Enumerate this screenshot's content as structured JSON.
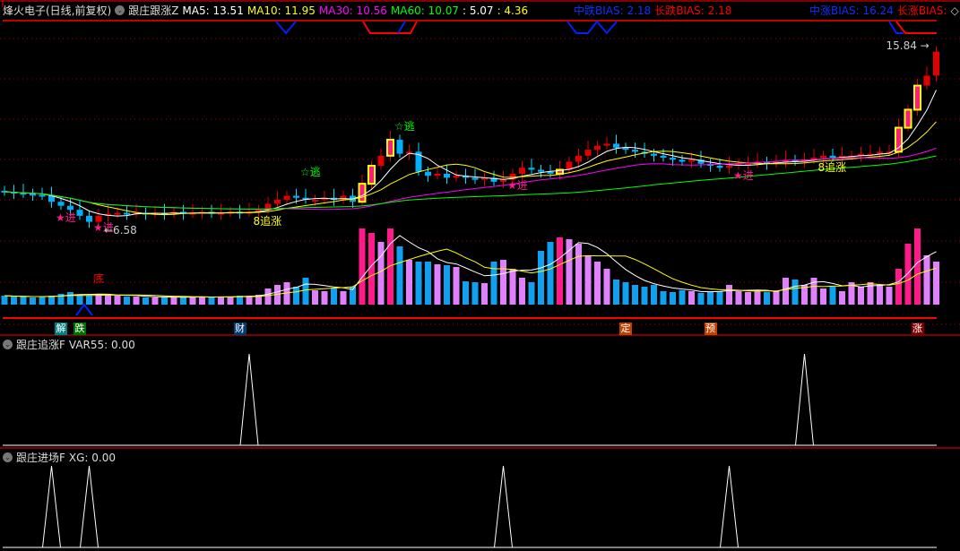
{
  "header": {
    "stock": "烽火电子(日线,前复权)",
    "indicator": "跟庄跟涨Z",
    "ma5": "MA5: 13.51",
    "ma10": "MA10: 11.95",
    "ma30": "MA30: 10.56",
    "ma60": "MA60: 10.07",
    "v1": ": 5.07",
    "v2": ": 4.36",
    "bias_mid_down": "中跌BIAS: 2.18",
    "bias_long_down": "长跌BIAS: 2.18",
    "bias_mid_up": "中涨BIAS: 16.24",
    "bias_long_up": "长涨BIAS:",
    "diamond": "◇"
  },
  "colors": {
    "up": "#e00000",
    "down": "#00b0ff",
    "signal": "#ff1a8c",
    "edge": "#ffff00",
    "ma5": "#ffffff",
    "ma10": "#ffff00",
    "ma30": "#ff00ff",
    "ma60": "#00ff00",
    "grid": "#800000",
    "axis": "#ff0000"
  },
  "panels": {
    "p1": {
      "title": "跟庄追涨F",
      "value": "VAR55: 0.00"
    },
    "p2": {
      "title": "跟庄进场F",
      "value": "XG: 0.00"
    }
  },
  "chart_data": {
    "type": "candlestick",
    "title": "烽火电子(日线,前复权)",
    "ylim": [
      6.3,
      16.2
    ],
    "closes": [
      8.5,
      8.45,
      8.4,
      8.35,
      8.3,
      8.0,
      7.8,
      7.6,
      7.3,
      7.0,
      7.3,
      7.4,
      7.45,
      7.4,
      7.45,
      7.4,
      7.45,
      7.4,
      7.5,
      7.4,
      7.45,
      7.5,
      7.4,
      7.45,
      7.5,
      7.45,
      7.5,
      7.6,
      7.9,
      8.1,
      8.3,
      8.2,
      8.1,
      8.1,
      8.2,
      8.1,
      8.3,
      8.0,
      8.9,
      9.8,
      10.3,
      11.1,
      10.4,
      10.5,
      9.5,
      9.3,
      9.4,
      9.2,
      9.3,
      9.2,
      9.1,
      9.2,
      9.0,
      9.1,
      9.4,
      9.7,
      9.6,
      9.5,
      9.4,
      9.6,
      10.0,
      10.3,
      10.6,
      10.8,
      10.9,
      10.7,
      10.6,
      10.5,
      10.4,
      10.3,
      10.2,
      10.1,
      10.0,
      10.1,
      9.9,
      9.8,
      9.7,
      9.8,
      9.9,
      9.9,
      10.0,
      9.9,
      10.0,
      10.1,
      10.0,
      10.1,
      10.2,
      10.3,
      10.2,
      10.3,
      10.3,
      10.4,
      10.4,
      10.5,
      10.5,
      11.7,
      12.6,
      13.8,
      14.3,
      15.5
    ],
    "signal_bars": [
      38,
      39,
      41,
      59,
      95,
      96,
      97
    ],
    "volumes": [
      10,
      9,
      9,
      8,
      9,
      10,
      12,
      14,
      11,
      10,
      12,
      11,
      10,
      9,
      9,
      8,
      8,
      9,
      8,
      8,
      9,
      9,
      8,
      9,
      9,
      10,
      10,
      11,
      18,
      22,
      25,
      20,
      30,
      16,
      15,
      18,
      15,
      20,
      85,
      80,
      70,
      85,
      65,
      50,
      48,
      48,
      45,
      44,
      42,
      26,
      25,
      24,
      48,
      50,
      40,
      30,
      25,
      60,
      70,
      75,
      73,
      68,
      55,
      48,
      40,
      28,
      25,
      22,
      20,
      22,
      15,
      14,
      16,
      15,
      13,
      14,
      15,
      22,
      15,
      14,
      15,
      14,
      15,
      30,
      28,
      22,
      30,
      18,
      20,
      15,
      25,
      20,
      25,
      22,
      20,
      40,
      68,
      85,
      55,
      48
    ],
    "max_volume": 90,
    "price_labels": [
      {
        "text": "6.58",
        "bar": 10
      },
      {
        "text": "15.84",
        "bar": 99
      }
    ],
    "annotations": [
      {
        "text": "☆逃",
        "bar": 32,
        "color": "#00ff00"
      },
      {
        "text": "☆逃",
        "bar": 42,
        "color": "#00ff00"
      },
      {
        "text": "★进",
        "bar": 6,
        "color": "#ff1a8c"
      },
      {
        "text": "★进",
        "bar": 10,
        "color": "#ff1a8c"
      },
      {
        "text": "★进",
        "bar": 54,
        "color": "#ff1a8c"
      },
      {
        "text": "★进",
        "bar": 78,
        "color": "#ff1a8c"
      },
      {
        "text": "8追涨",
        "bar": 27,
        "color": "#ffff00"
      },
      {
        "text": "8追涨",
        "bar": 87,
        "color": "#ffff00"
      },
      {
        "text": "底",
        "bar": 10,
        "color": "#ff0000"
      }
    ],
    "markers": [
      {
        "text": "解",
        "bar": 6,
        "bg": "#008080"
      },
      {
        "text": "跌",
        "bar": 8,
        "bg": "#007000"
      },
      {
        "text": "财",
        "bar": 25,
        "bg": "#003c70"
      },
      {
        "text": "定",
        "bar": 66,
        "bg": "#c04000"
      },
      {
        "text": "预",
        "bar": 75,
        "bg": "#c04000"
      },
      {
        "text": "涨",
        "bar": 97,
        "bg": "#800000"
      }
    ],
    "var55_peaks": [
      26,
      85
    ],
    "xg_peaks": [
      5,
      9,
      53,
      77
    ]
  }
}
